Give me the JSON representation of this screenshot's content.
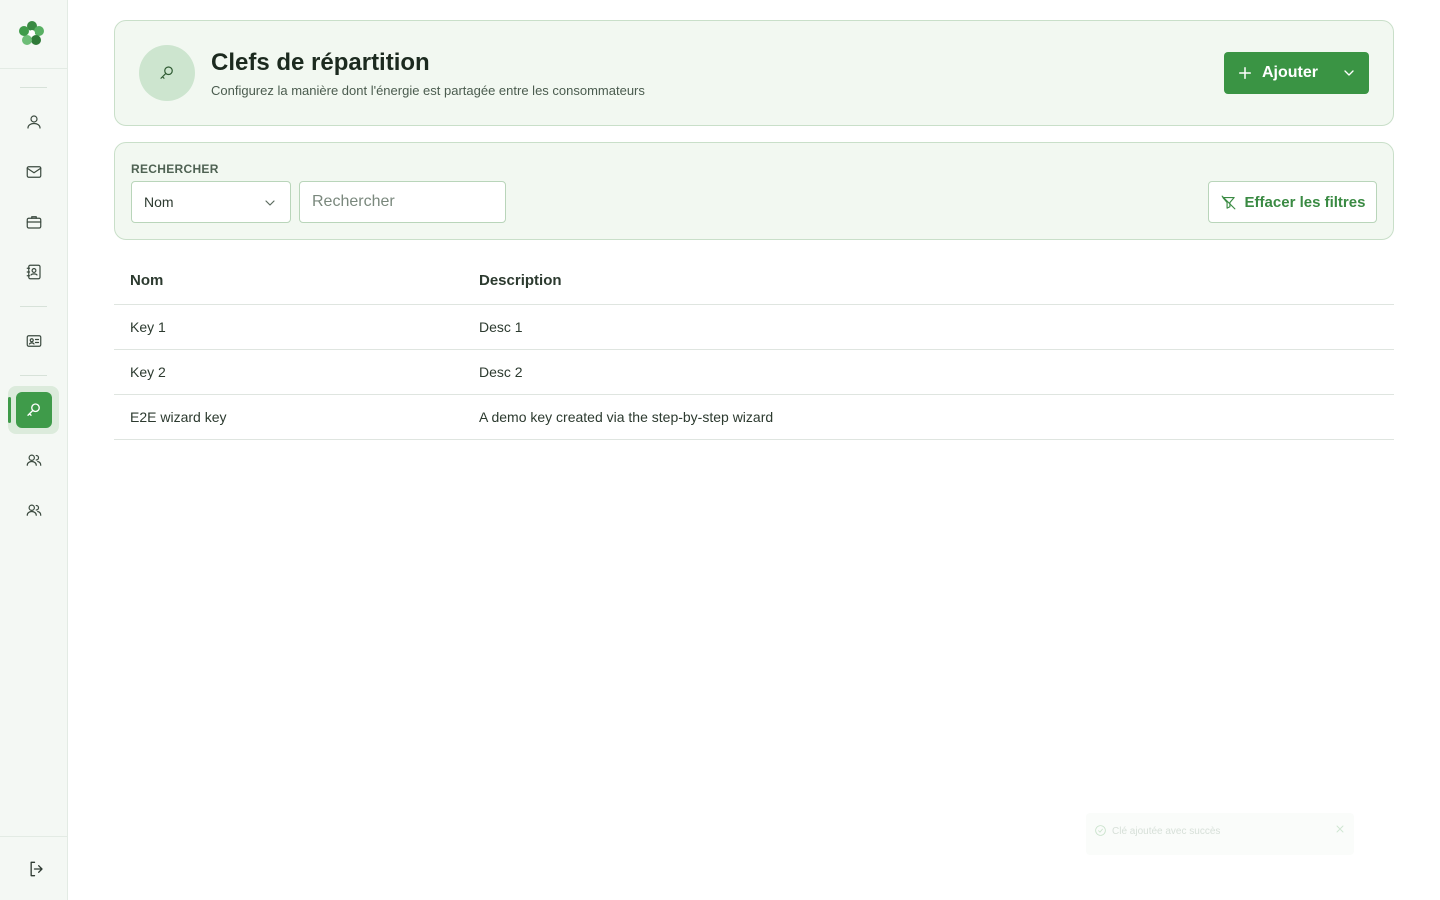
{
  "header": {
    "title": "Clefs de répartition",
    "subtitle": "Configurez la manière dont l'énergie est partagée entre les consommateurs",
    "add_label": "Ajouter"
  },
  "filters": {
    "section_label": "RECHERCHER",
    "field_selected": "Nom",
    "search_placeholder": "Rechercher",
    "clear_label": "Effacer les filtres"
  },
  "table": {
    "columns": [
      "Nom",
      "Description"
    ],
    "rows": [
      {
        "name": "Key 1",
        "description": "Desc 1"
      },
      {
        "name": "Key 2",
        "description": "Desc 2"
      },
      {
        "name": "E2E wizard key",
        "description": "A demo key created via the step-by-step wizard"
      }
    ]
  },
  "sidebar": {
    "items": [
      {
        "icon": "user-icon"
      },
      {
        "icon": "mail-icon"
      },
      {
        "icon": "briefcase-icon"
      },
      {
        "icon": "contact-book-icon"
      },
      {
        "icon": "id-card-icon"
      },
      {
        "icon": "key-icon",
        "active": true
      },
      {
        "icon": "users-icon"
      },
      {
        "icon": "users-icon"
      }
    ],
    "logout_icon": "logout-icon"
  },
  "toast": {
    "message": "Clé ajoutée avec succès"
  },
  "colors": {
    "accent": "#3a9444",
    "card_bg": "#f2f8f1",
    "card_border": "#c9dfc9"
  }
}
